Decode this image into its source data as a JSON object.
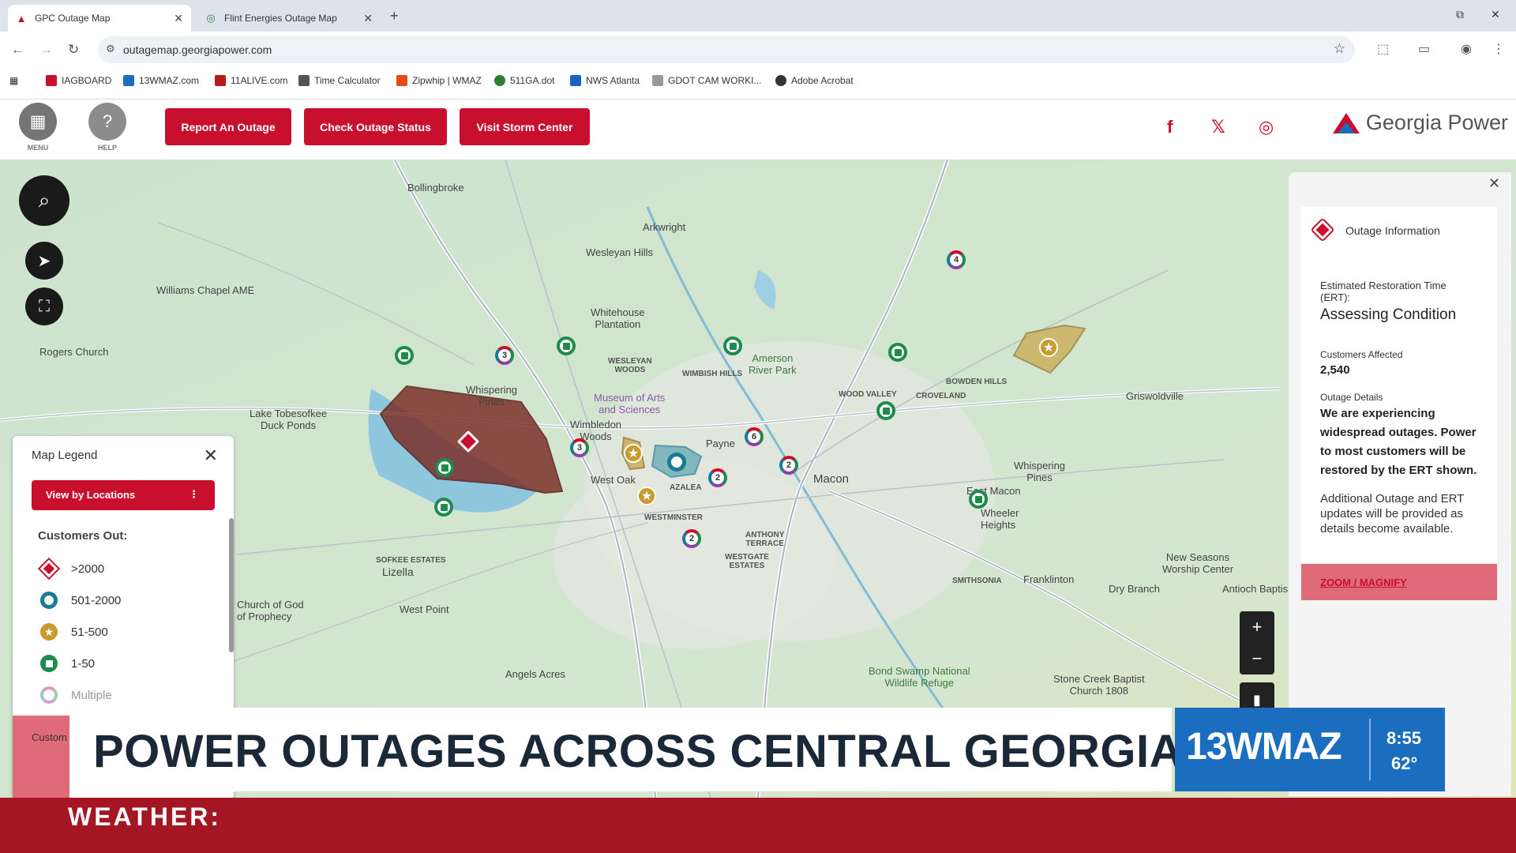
{
  "browser": {
    "tabs": [
      {
        "title": "GPC Outage Map"
      },
      {
        "title": "Flint Energies Outage Map"
      }
    ],
    "url": "outagemap.georgiapower.com",
    "bookmarks": [
      "IAGBOARD",
      "13WMAZ.com",
      "11ALIVE.com",
      "Time Calculator",
      "Zipwhip | WMAZ",
      "511GA.dot",
      "NWS Atlanta",
      "GDOT CAM WORKI...",
      "Adobe Acrobat"
    ]
  },
  "header": {
    "menu_label": "MENU",
    "help_label": "HELP",
    "buttons": [
      "Report An Outage",
      "Check Outage Status",
      "Visit Storm Center"
    ],
    "brand": "Georgia Power"
  },
  "map": {
    "labels": {
      "bollingbroke": "Bollingbroke",
      "arkwright": "Arkwright",
      "wesleyan_hills": "Wesleyan Hills",
      "williams_chapel": "Williams Chapel AME",
      "whitehouse": "Whitehouse\nPlantation",
      "rogers_church": "Rogers Church",
      "whispering_pines": "Whispering\nPines",
      "wesleyan_woods": "WESLEYAN\nWOODS",
      "wimbish_hills": "WIMBISH HILLS",
      "amerson": "Amerson\nRiver Park",
      "wood_valley": "WOOD VALLEY",
      "croveland": "CROVELAND",
      "bowden_hills": "BOWDEN HILLS",
      "griswoldville": "Griswoldville",
      "lake_tobesofkee": "Lake Tobesofkee\nDuck Ponds",
      "museum": "Museum of Arts\nand Sciences",
      "wimbledon": "Wimbledon\nWoods",
      "payne": "Payne",
      "west_oak": "West Oak",
      "azalea": "AZALEA",
      "westminster": "WESTMINSTER",
      "macon": "Macon",
      "whispering_pines_2": "Whispering\nPines",
      "east_macon": "East Macon",
      "wheeler": "Wheeler\nHeights",
      "anthony_terrace": "ANTHONY\nTERRACE",
      "westgate": "WESTGATE\nESTATES",
      "sofkee": "SOFKEE ESTATES",
      "lizella": "Lizella",
      "church_of_god": "Church of God\nof Prophecy",
      "west_point": "West Point",
      "smithsonia": "SMITHSONIA",
      "franklinton": "Franklinton",
      "dry_branch": "Dry Branch",
      "new_seasons": "New Seasons\nWorship Center",
      "antioch": "Antioch Baptis",
      "angels_acres": "Angels Acres",
      "bond_swamp": "Bond Swamp National\nWildlife Refuge",
      "stone_creek": "Stone Creek Baptist\nChurch 1808"
    },
    "cluster_counts": {
      "a": "3",
      "b": "3",
      "c": "6",
      "d": "2",
      "e": "2",
      "f": "2",
      "g": "4"
    }
  },
  "legend": {
    "title": "Map Legend",
    "view_button": "View by Locations",
    "customers_out_label": "Customers Out:",
    "rows": [
      ">2000",
      "501-2000",
      "51-500",
      "1-50",
      "Multiple"
    ],
    "stub_label": "Custom"
  },
  "info_panel": {
    "title": "Outage Information",
    "ert_label": "Estimated Restoration Time\n(ERT):",
    "ert_value": "Assessing Condition",
    "customers_label": "Customers Affected",
    "customers_value": "2,540",
    "details_label": "Outage Details",
    "details_bold": "We are experiencing widespread outages. Power to most customers will be restored by the ERT shown.",
    "details_more": "Additional Outage and ERT updates will be provided as details become available.",
    "zoom_link": "ZOOM / MAGNIFY"
  },
  "broadcast": {
    "headline": "POWER OUTAGES ACROSS CENTRAL GEORGIA",
    "station": "13WMAZ",
    "time": "8:55",
    "temp": "62°",
    "ticker": "WEATHER:"
  },
  "colors": {
    "brand_red": "#c8102e",
    "ticker_red": "#a51624",
    "station_blue": "#1a6dbf"
  }
}
